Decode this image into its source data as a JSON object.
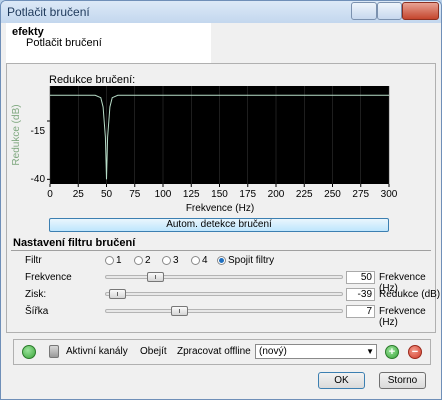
{
  "window": {
    "title": "Potlačit bručení"
  },
  "header": {
    "category": "efekty",
    "effect_name": "Potlačit bručení"
  },
  "graph": {
    "label": "Redukce bručení:",
    "y_label": "Redukce (dB)",
    "x_label": "Frekvence (Hz)",
    "y_ticks": [
      "-15",
      "-40"
    ],
    "x_ticks": [
      "0",
      "25",
      "50",
      "75",
      "100",
      "125",
      "150",
      "175",
      "200",
      "225",
      "250",
      "275",
      "300"
    ]
  },
  "chart_data": {
    "type": "line",
    "title": "Redukce bručení:",
    "xlabel": "Frekvence (Hz)",
    "ylabel": "Redukce (dB)",
    "xlim": [
      0,
      300
    ],
    "ylim": [
      -42,
      0
    ],
    "series": [
      {
        "x": [
          0,
          25,
          40,
          45,
          47,
          49,
          50,
          51,
          53,
          55,
          60,
          75,
          100,
          300
        ],
        "values": [
          -4,
          -4,
          -4,
          -5,
          -9,
          -22,
          -40,
          -22,
          -9,
          -5,
          -4,
          -4,
          -4,
          -4
        ]
      }
    ]
  },
  "auto_detect_label": "Autom. detekce bručení",
  "filter_section": {
    "title": "Nastavení filtru bručení",
    "filter_label": "Filtr",
    "radios": [
      {
        "label": "1",
        "checked": false
      },
      {
        "label": "2",
        "checked": false
      },
      {
        "label": "3",
        "checked": false
      },
      {
        "label": "4",
        "checked": false
      },
      {
        "label": "Spojit filtry",
        "checked": true
      }
    ],
    "sliders": [
      {
        "label": "Frekvence",
        "value": "50",
        "unit": "Frekvence (Hz)",
        "position": 0.19
      },
      {
        "label": "Zisk:",
        "value": "-39",
        "unit": "Redukce (dB)",
        "position": 0.02
      },
      {
        "label": "Šířka",
        "value": "7",
        "unit": "Frekvence (Hz)",
        "position": 0.3
      }
    ]
  },
  "bottom_bar": {
    "active_channels": "Aktivní kanály",
    "bypass": "Obejít",
    "process_offline": "Zpracovat offline",
    "preset_selected": "(nový)"
  },
  "buttons": {
    "ok": "OK",
    "cancel": "Storno"
  },
  "colors": {
    "plot_bg": "#000000",
    "curve": "#b8ddc8",
    "grid": "#3c3c3c",
    "green_button": "#3aa63a",
    "red_button": "#d23a2a"
  }
}
